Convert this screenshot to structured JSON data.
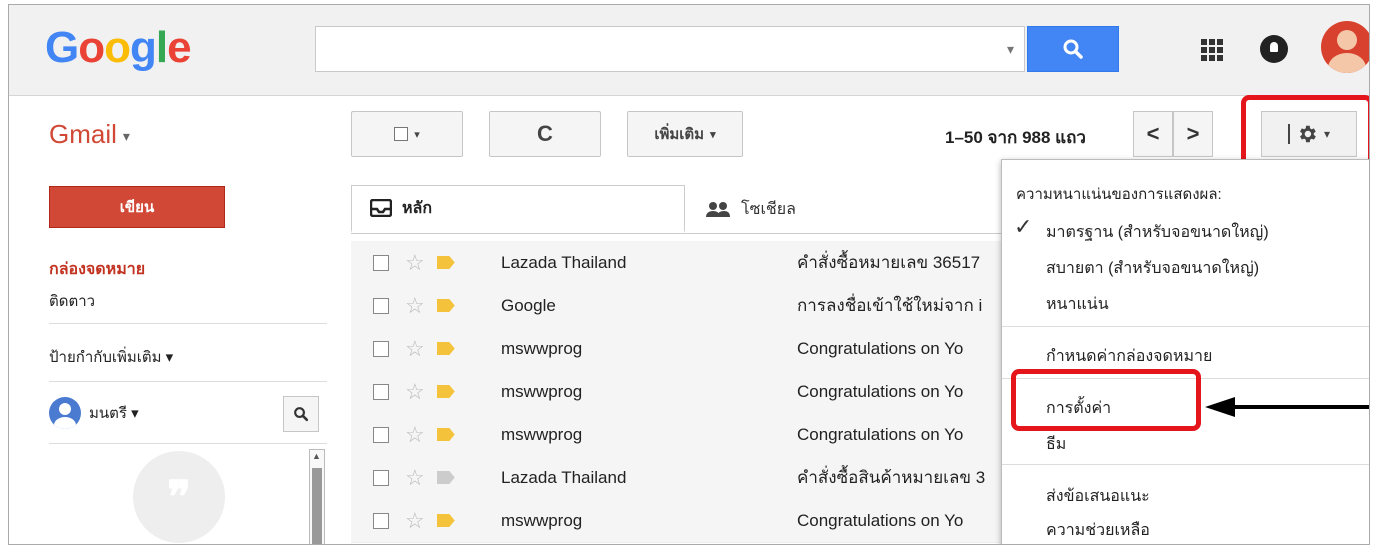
{
  "header": {
    "logo_letters": [
      {
        "ch": "G",
        "color": "#4285F4"
      },
      {
        "ch": "o",
        "color": "#EA4335"
      },
      {
        "ch": "o",
        "color": "#FBBC05"
      },
      {
        "ch": "g",
        "color": "#4285F4"
      },
      {
        "ch": "l",
        "color": "#34A853"
      },
      {
        "ch": "e",
        "color": "#EA4335"
      }
    ],
    "search_value": "",
    "search_icon": "search-icon",
    "apps_icon": "apps-grid-icon",
    "notifications_icon": "notifications-icon"
  },
  "toolbar": {
    "gmail_label": "Gmail",
    "refresh_glyph": "C",
    "more_label": "เพิ่มเติม",
    "page_count": "1–50 จาก 988 แถว",
    "prev_glyph": "<",
    "next_glyph": ">"
  },
  "sidebar": {
    "compose_label": "เขียน",
    "inbox_label": "กล่องจดหมาย",
    "followup_label": "ติดตาว",
    "more_labels": "ป้ายกำกับเพิ่มเติม ▾",
    "user_name": "มนตรี ▾",
    "hangout_glyph": "❞"
  },
  "tabs": {
    "primary": "หลัก",
    "social": "โซเชียล"
  },
  "emails": [
    {
      "sender": "Lazada Thailand",
      "subject": "คำสั่งซื้อหมายเลข 36517",
      "important": true
    },
    {
      "sender": "Google",
      "subject": "การลงชื่อเข้าใช้ใหม่จาก i",
      "important": true
    },
    {
      "sender": "mswwprog",
      "subject": "Congratulations on Yo",
      "important": true
    },
    {
      "sender": "mswwprog",
      "subject": "Congratulations on Yo",
      "important": true
    },
    {
      "sender": "mswwprog",
      "subject": "Congratulations on Yo",
      "important": true
    },
    {
      "sender": "Lazada Thailand",
      "subject": "คำสั่งซื้อสินค้าหมายเลข 3",
      "important": false
    },
    {
      "sender": "mswwprog",
      "subject": "Congratulations on Yo",
      "important": true
    }
  ],
  "settings_menu": {
    "density_header": "ความหนาแน่นของการแสดงผล:",
    "check_glyph": "✓",
    "standard": "มาตรฐาน (สำหรับจอขนาดใหญ่)",
    "comfortable": "สบายตา (สำหรับจอขนาดใหญ่)",
    "compact": "หนาแน่น",
    "configure_inbox": "กำหนดค่ากล่องจดหมาย",
    "settings": "การตั้งค่า",
    "themes": "ธีม",
    "send_feedback": "ส่งข้อเสนอแนะ",
    "help": "ความช่วยเหลือ"
  },
  "colors": {
    "accent_red": "#D14836",
    "highlight_red": "#E4161C",
    "search_blue": "#4285F4"
  }
}
